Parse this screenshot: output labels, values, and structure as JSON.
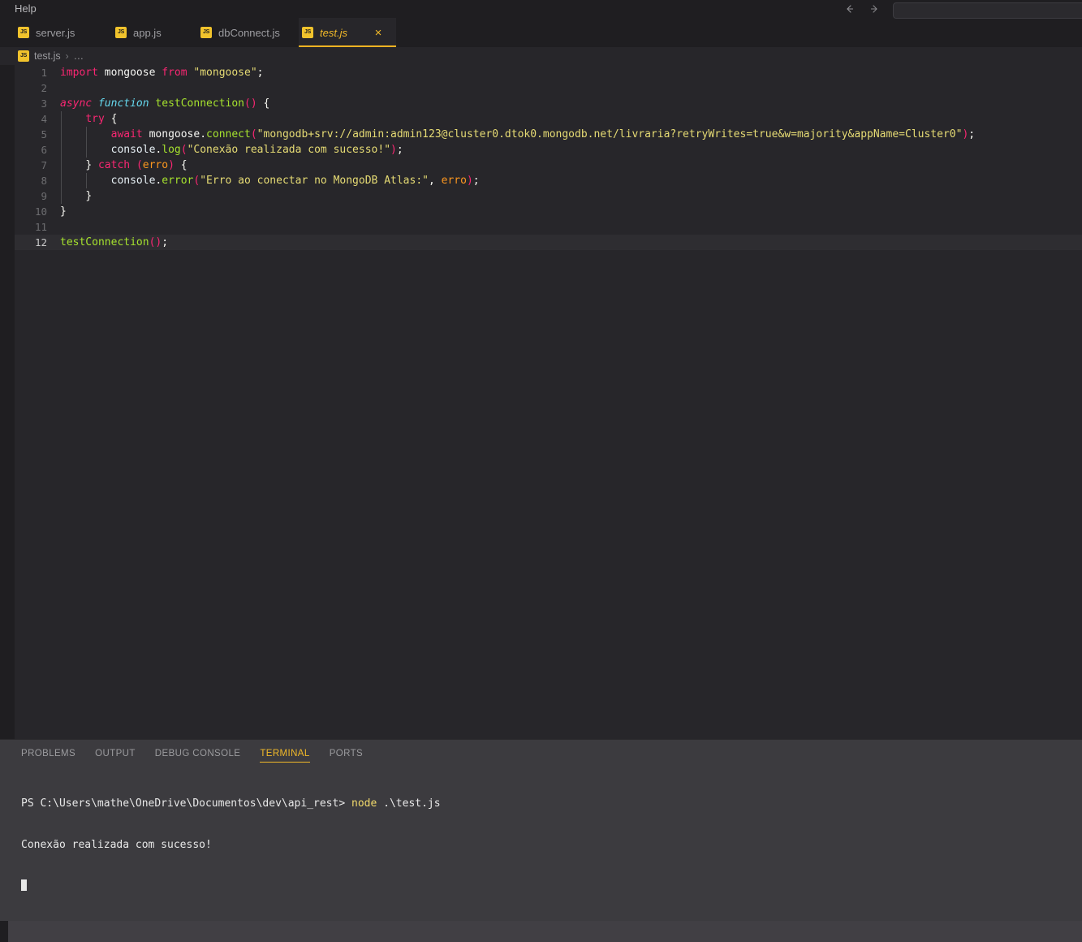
{
  "titlebar": {
    "menu": [
      {
        "label": "Help"
      }
    ],
    "nav_back_icon": "arrow-left-icon",
    "nav_forward_icon": "arrow-right-icon",
    "search_value": "",
    "search_placeholder": ""
  },
  "tabs": [
    {
      "label": "server.js",
      "icon": "js-file-icon",
      "badge": "JS",
      "active": false
    },
    {
      "label": "app.js",
      "icon": "js-file-icon",
      "badge": "JS",
      "active": false
    },
    {
      "label": "dbConnect.js",
      "icon": "js-file-icon",
      "badge": "JS",
      "active": false
    },
    {
      "label": "test.js",
      "icon": "js-file-icon",
      "badge": "JS",
      "active": true,
      "close_icon": "close-icon",
      "close_glyph": "×"
    }
  ],
  "breadcrumb": {
    "badge": "JS",
    "file": "test.js",
    "separator": "›",
    "overflow": "…"
  },
  "editor": {
    "active_line": 12,
    "lines": [
      {
        "n": "1",
        "text": "import mongoose from \"mongoose\";"
      },
      {
        "n": "2",
        "text": ""
      },
      {
        "n": "3",
        "text": "async function testConnection() {"
      },
      {
        "n": "4",
        "text": "    try {"
      },
      {
        "n": "5",
        "text": "        await mongoose.connect(\"mongodb+srv://admin:admin123@cluster0.dtok0.mongodb.net/livraria?retryWrites=true&w=majority&appName=Cluster0\");"
      },
      {
        "n": "6",
        "text": "        console.log(\"Conexão realizada com sucesso!\");"
      },
      {
        "n": "7",
        "text": "    } catch (erro) {"
      },
      {
        "n": "8",
        "text": "        console.error(\"Erro ao conectar no MongoDB Atlas:\", erro);"
      },
      {
        "n": "9",
        "text": "    }"
      },
      {
        "n": "10",
        "text": "}"
      },
      {
        "n": "11",
        "text": ""
      },
      {
        "n": "12",
        "text": "testConnection();"
      }
    ]
  },
  "panel": {
    "tabs": [
      {
        "label": "PROBLEMS",
        "active": false
      },
      {
        "label": "OUTPUT",
        "active": false
      },
      {
        "label": "DEBUG CONSOLE",
        "active": false
      },
      {
        "label": "TERMINAL",
        "active": true
      },
      {
        "label": "PORTS",
        "active": false
      }
    ],
    "terminal": {
      "prompt": "PS C:\\Users\\mathe\\OneDrive\\Documentos\\dev\\api_rest> ",
      "command_keyword": "node",
      "command_args": " .\\test.js",
      "output": "Conexão realizada com sucesso!"
    }
  },
  "colors": {
    "accent": "#f1b929",
    "editor_bg": "#27262a",
    "chrome_bg": "#1f1e21",
    "panel_bg": "#3c3b3f",
    "statusbar_bg": "#413f44",
    "keyword": "#f92672",
    "string": "#e6db74",
    "function": "#a6e22e",
    "type": "#66d9ef",
    "parameter": "#fd971f",
    "identifier": "#f8f8f2",
    "line_number": "#6d6d70"
  }
}
